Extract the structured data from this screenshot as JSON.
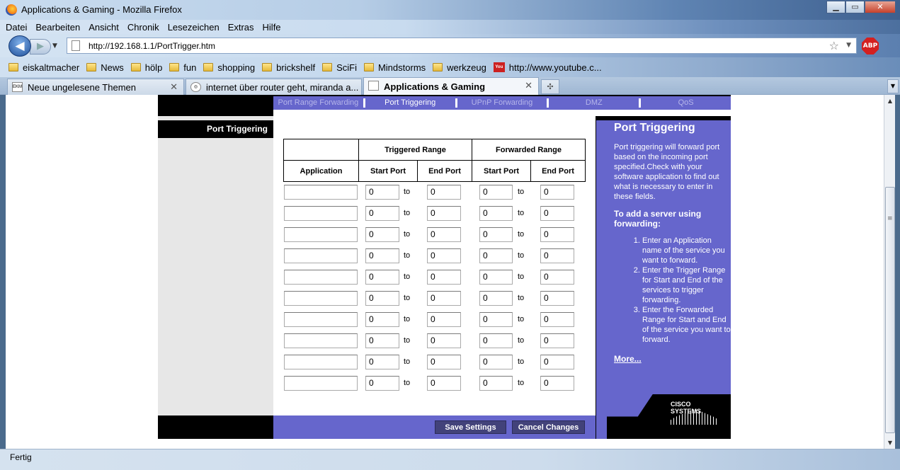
{
  "window": {
    "title": "Applications & Gaming - Mozilla Firefox",
    "min": "▁",
    "max": "▭",
    "close": "✕"
  },
  "menu": [
    "Datei",
    "Bearbeiten",
    "Ansicht",
    "Chronik",
    "Lesezeichen",
    "Extras",
    "Hilfe"
  ],
  "nav": {
    "url": "http://192.168.1.1/PortTrigger.htm",
    "back_icon": "◀",
    "fwd_icon": "▶",
    "abp": "ABP"
  },
  "bookmarks": [
    {
      "label": "eiskaltmacher",
      "icon": "folder-icon"
    },
    {
      "label": "News",
      "icon": "folder-icon"
    },
    {
      "label": "hölp",
      "icon": "folder-icon"
    },
    {
      "label": "fun",
      "icon": "folder-icon"
    },
    {
      "label": "shopping",
      "icon": "folder-icon"
    },
    {
      "label": "brickshelf",
      "icon": "folder-icon"
    },
    {
      "label": "SciFi",
      "icon": "folder-icon"
    },
    {
      "label": "Mindstorms",
      "icon": "folder-icon"
    },
    {
      "label": "werkzeug",
      "icon": "folder-icon"
    },
    {
      "label": "http://www.youtube.c...",
      "icon": "youtube-icon"
    }
  ],
  "tabs": [
    {
      "label": "Neue ungelesene Themen",
      "icon": "EKM"
    },
    {
      "label": "internet über router geht, miranda a...",
      "icon": "◎"
    },
    {
      "label": "Applications & Gaming",
      "icon": ""
    }
  ],
  "status": "Fertig",
  "router": {
    "subnav": [
      "Port Range Forwarding",
      "Port Triggering",
      "UPnP Forwarding",
      "DMZ",
      "QoS"
    ],
    "active_subnav": "Port Triggering",
    "left_heading": "Port Triggering",
    "table": {
      "group_triggered": "Triggered Range",
      "group_forwarded": "Forwarded Range",
      "col_application": "Application",
      "col_start": "Start Port",
      "col_end": "End Port",
      "to_label": "to",
      "rows": [
        {
          "app": "",
          "ts": "0",
          "te": "0",
          "fs": "0",
          "fe": "0"
        },
        {
          "app": "",
          "ts": "0",
          "te": "0",
          "fs": "0",
          "fe": "0"
        },
        {
          "app": "",
          "ts": "0",
          "te": "0",
          "fs": "0",
          "fe": "0"
        },
        {
          "app": "",
          "ts": "0",
          "te": "0",
          "fs": "0",
          "fe": "0"
        },
        {
          "app": "",
          "ts": "0",
          "te": "0",
          "fs": "0",
          "fe": "0"
        },
        {
          "app": "",
          "ts": "0",
          "te": "0",
          "fs": "0",
          "fe": "0"
        },
        {
          "app": "",
          "ts": "0",
          "te": "0",
          "fs": "0",
          "fe": "0"
        },
        {
          "app": "",
          "ts": "0",
          "te": "0",
          "fs": "0",
          "fe": "0"
        },
        {
          "app": "",
          "ts": "0",
          "te": "0",
          "fs": "0",
          "fe": "0"
        },
        {
          "app": "",
          "ts": "0",
          "te": "0",
          "fs": "0",
          "fe": "0"
        }
      ]
    },
    "help": {
      "title": "Port Triggering",
      "intro": "Port triggering will forward port based on the incoming port specified.Check with your software application to find out what is necessary to enter in these fields.",
      "subtitle": "To add a server using forwarding:",
      "steps": [
        "Enter an Application name of the service you want to forward.",
        "Enter the Trigger Range for Start and End of the services to trigger forwarding.",
        "Enter the Forwarded Range for Start and End of the service you want to forward."
      ],
      "more": "More..."
    },
    "cisco": "CISCO SYSTEMS",
    "buttons": {
      "save": "Save Settings",
      "cancel": "Cancel Changes"
    }
  }
}
